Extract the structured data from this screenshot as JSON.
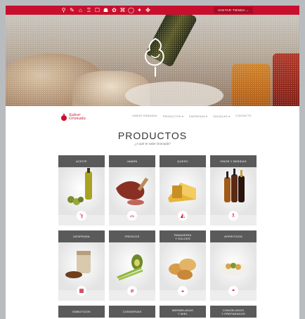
{
  "topbar": {
    "icons": [
      "⚲",
      "✎",
      "⌂",
      "♖",
      "☐",
      "☗",
      "✿",
      "⌘",
      "◯",
      "✦",
      "✤"
    ],
    "visit_button": "VISITAR TIENDA ⌄"
  },
  "nav": {
    "brand": "Sabor\nGranada",
    "items": [
      "SABOR GRANADA",
      "PRODUCTOS ▾",
      "EMPRESAS ▾",
      "SÍGUELAS ▾",
      "CONTACTO"
    ]
  },
  "main": {
    "title": "PRODUCTOS",
    "subtitle": "¿A qué te sabe Granada?"
  },
  "categories": [
    {
      "label": "ACEITE",
      "icon": "ℽ",
      "image": "olive-oil-bottle"
    },
    {
      "label": "JAMÓN",
      "icon": "⌓",
      "image": "ham-leg"
    },
    {
      "label": "QUESO",
      "icon": "◭",
      "image": "cheese"
    },
    {
      "label": "VINOS Y BEBIDAS",
      "icon": "♗",
      "image": "wine-bottles"
    },
    {
      "label": "DESPENSA",
      "icon": "▦",
      "image": "pantry-jar"
    },
    {
      "label": "FRESCOS",
      "icon": "⌀",
      "image": "fresh-vegetables"
    },
    {
      "label": "PANADERÍA\nY DULCES",
      "icon": "◒",
      "image": "bread-rolls"
    },
    {
      "label": "APERITIVOS",
      "icon": "◓",
      "image": "appetizer-bowl"
    },
    {
      "label": "EMBUTIDOS",
      "icon": "",
      "image": ""
    },
    {
      "label": "CONSERVAS",
      "icon": "",
      "image": ""
    },
    {
      "label": "MERMELADAS\nY MIEL",
      "icon": "",
      "image": ""
    },
    {
      "label": "CONGELADOS\nY PREPARADOS",
      "icon": "",
      "image": ""
    }
  ],
  "colors": {
    "brand": "#c8102e",
    "tile_header": "#5a5a5a"
  }
}
